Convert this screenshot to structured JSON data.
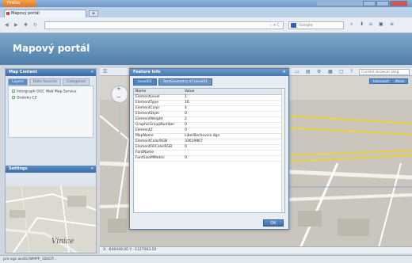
{
  "browser": {
    "app_button": "Firefox",
    "tab_title": "Mapový portál",
    "new_tab": "+",
    "url": "",
    "search_placeholder": "Google"
  },
  "portal": {
    "title": "Mapový portál"
  },
  "left_panel": {
    "content_title": "Map Content",
    "tabs": [
      "Layers",
      "Data Sources",
      "Categories"
    ],
    "tree": [
      "Intergraph OGC Web Map Service",
      "Orotoku CZ"
    ],
    "settings_title": "Settings"
  },
  "map": {
    "search_placeholder": "Current browser lang",
    "buttons": [
      "Intersect",
      "More"
    ],
    "minimap_label": "Vinice",
    "coords": "X: -646448.00  Y: -1127063.50"
  },
  "dialog": {
    "title": "Feature Info",
    "tabs": [
      "Level01",
      "TextGeometry of Level01"
    ],
    "columns": [
      "Name",
      "Value"
    ],
    "rows": [
      [
        "ElementLevel",
        "1"
      ],
      [
        "ElementType",
        "16"
      ],
      [
        "ElementColor",
        "4"
      ],
      [
        "ElementStyle",
        "0"
      ],
      [
        "ElementWeight",
        "2"
      ],
      [
        "GraphicGroupNumber",
        "0"
      ],
      [
        "ElementZ",
        "0"
      ],
      [
        "MapName",
        "LiberBechovice.dgn"
      ],
      [
        "ElementColorRGB",
        "33619967"
      ],
      [
        "ElementFillColorRGB",
        "0"
      ],
      [
        "FontName",
        ""
      ],
      [
        "FontSizeMMetric",
        "0"
      ]
    ],
    "ok_label": "OK"
  },
  "status": {
    "text": "pre-ogc-ws4G/WMPP_1DSCP..."
  }
}
